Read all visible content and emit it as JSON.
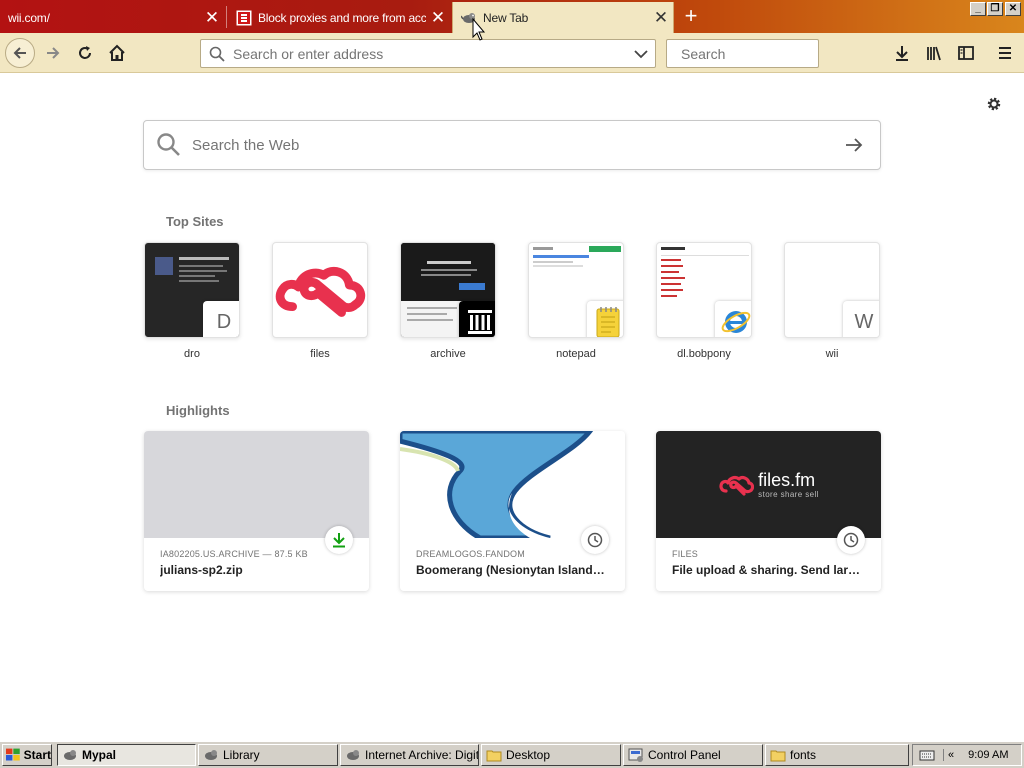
{
  "tabs": [
    {
      "title": "wii.com/",
      "active": false
    },
    {
      "title": "Block proxies and more from acce",
      "active": false
    },
    {
      "title": "New Tab",
      "active": true
    }
  ],
  "toolbar": {
    "url_placeholder": "Search or enter address",
    "search_placeholder": "Search"
  },
  "content": {
    "web_search_placeholder": "Search the Web",
    "top_sites_heading": "Top Sites",
    "highlights_heading": "Highlights"
  },
  "top_sites": [
    {
      "label": "dro",
      "badge": "D"
    },
    {
      "label": "files",
      "badge": ""
    },
    {
      "label": "archive",
      "badge": ""
    },
    {
      "label": "notepad",
      "badge": ""
    },
    {
      "label": "dl.bobpony",
      "badge": ""
    },
    {
      "label": "wii",
      "badge": "W"
    }
  ],
  "highlights": [
    {
      "source": "IA802205.US.ARCHIVE — 87.5 KB",
      "title": "julians-sp2.zip",
      "badge_icon": "download-icon"
    },
    {
      "source": "DREAMLOGOS.FANDOM",
      "title": "Boomerang (Nesionytan Islands) ...",
      "badge_icon": "clock-icon"
    },
    {
      "source": "FILES",
      "title": "File upload & sharing. Send large...",
      "badge_icon": "clock-icon",
      "image_brand": "files.fm",
      "image_tagline": "store share sell"
    }
  ],
  "taskbar": {
    "start_label": "Start",
    "tasks": [
      {
        "label": "Mypal",
        "active": true
      },
      {
        "label": "Library",
        "active": false
      },
      {
        "label": "Internet Archive: Digit...",
        "active": false
      },
      {
        "label": "Desktop",
        "active": false
      },
      {
        "label": "Control Panel",
        "active": false
      },
      {
        "label": "fonts",
        "active": false
      }
    ],
    "tray_chevron": "«",
    "clock": "9:09 AM"
  },
  "colors": {
    "tabstrip_start": "#b31212",
    "tabstrip_end": "#d9861c",
    "toolbar_bg": "#f2e7c2",
    "files_red": "#e8314e",
    "download_green": "#12a012"
  }
}
